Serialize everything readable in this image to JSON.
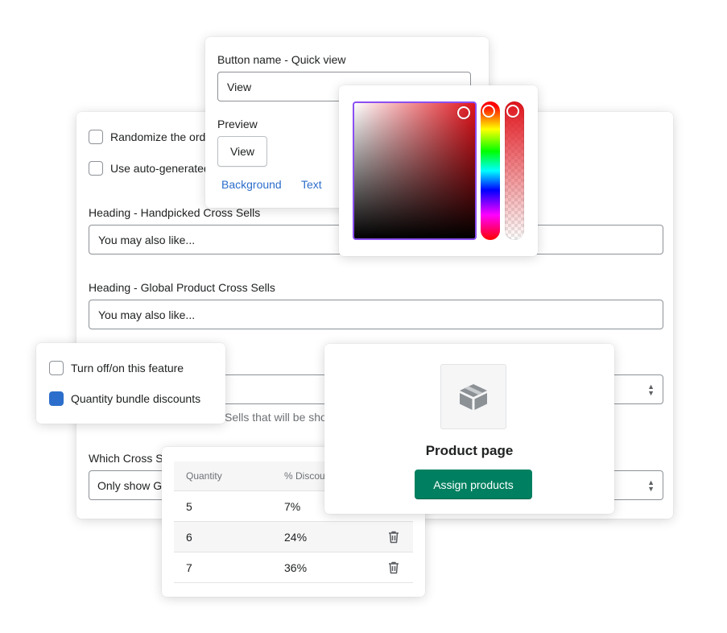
{
  "settings": {
    "randomize_label": "Randomize the orde",
    "auto_generated_label": "Use auto-generated",
    "handpicked_heading_label": "Heading - Handpicked Cross Sells",
    "handpicked_heading_value": "You may also like...",
    "global_heading_label": "Heading - Global Product Cross Sells",
    "global_heading_value": "You may also like...",
    "help_text": "Sells that will be sho",
    "which_label": "Which Cross S",
    "which_value": "Only show Gl"
  },
  "button_popover": {
    "name_label": "Button name - Quick view",
    "name_value": "View",
    "preview_label": "Preview",
    "preview_button": "View",
    "background_link": "Background",
    "text_link": "Text"
  },
  "color_picker": {
    "hue_color": "#e0141c",
    "selection_border": "#8a4ff2"
  },
  "features": {
    "toggle_label": "Turn off/on this feature",
    "bundle_label": "Quantity bundle discounts",
    "bundle_checked": true
  },
  "quantity_table": {
    "headers": [
      "Quantity",
      "% Discou"
    ],
    "rows": [
      {
        "qty": "5",
        "discount": "7%"
      },
      {
        "qty": "6",
        "discount": "24%"
      },
      {
        "qty": "7",
        "discount": "36%"
      }
    ]
  },
  "product_card": {
    "title": "Product page",
    "assign_button": "Assign products",
    "icon": "package-icon"
  },
  "colors": {
    "primary": "#008060",
    "link": "#2c6ecb",
    "checkbox_checked": "#2c6ecb"
  }
}
